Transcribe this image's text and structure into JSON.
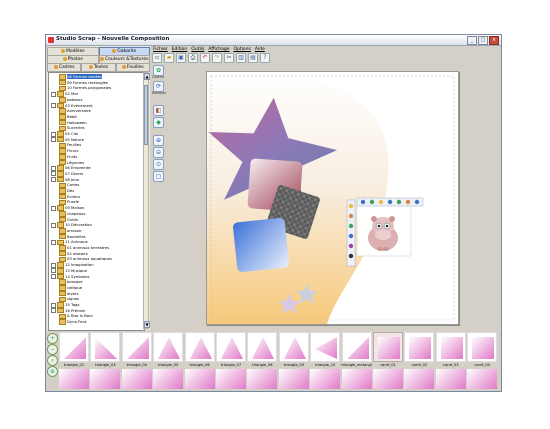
{
  "window": {
    "title": "Studio Scrap - Nouvelle Composition",
    "buttons": [
      "_",
      "□",
      "×"
    ]
  },
  "left_tabs": {
    "row1": [
      "Modèles",
      "Gabarits"
    ],
    "row2": [
      "Photos",
      "Couleurs &Textures"
    ],
    "row3": [
      "Cadres",
      "Textes",
      "Feuilles"
    ]
  },
  "tree": [
    {
      "label": "08 Formes carrées",
      "level": 2,
      "selected": true
    },
    {
      "label": "09 Formes rectangles",
      "level": 2
    },
    {
      "label": "10 Formes polygonales",
      "level": 2
    },
    {
      "label": "02 Mer",
      "level": 1
    },
    {
      "label": "bateaux",
      "level": 2
    },
    {
      "label": "03 Evénement",
      "level": 1
    },
    {
      "label": "Anniversaire",
      "level": 2
    },
    {
      "label": "Bébé",
      "level": 2
    },
    {
      "label": "Halloween",
      "level": 2
    },
    {
      "label": "Sucreries",
      "level": 2
    },
    {
      "label": "04 Ciel",
      "level": 1
    },
    {
      "label": "05 Nature",
      "level": 1
    },
    {
      "label": "Feuilles",
      "level": 2
    },
    {
      "label": "Fleurs",
      "level": 2
    },
    {
      "label": "Fruits",
      "level": 2
    },
    {
      "label": "Légumes",
      "level": 2
    },
    {
      "label": "06 Empreinte",
      "level": 1
    },
    {
      "label": "07 Divers",
      "level": 1
    },
    {
      "label": "08 Jeux",
      "level": 1
    },
    {
      "label": "Cartes",
      "level": 2
    },
    {
      "label": "Dés",
      "level": 2
    },
    {
      "label": "Echecs",
      "level": 2
    },
    {
      "label": "Puzzle",
      "level": 2
    },
    {
      "label": "09 Maison",
      "level": 1
    },
    {
      "label": "chapeaux",
      "level": 2
    },
    {
      "label": "Outils",
      "level": 2
    },
    {
      "label": "10 Décoration",
      "level": 1
    },
    {
      "label": "arrosoir",
      "level": 2
    },
    {
      "label": "Bouteilles",
      "level": 2
    },
    {
      "label": "11 Animaux",
      "level": 1
    },
    {
      "label": "01 animaux terrestres",
      "level": 2
    },
    {
      "label": "02 oiseaux",
      "level": 2
    },
    {
      "label": "03 animaux aquatiques",
      "level": 2
    },
    {
      "label": "12 Imagination",
      "level": 1
    },
    {
      "label": "13 Musique",
      "level": 1
    },
    {
      "label": "14 Symboles",
      "level": 1
    },
    {
      "label": "baroque",
      "level": 2
    },
    {
      "label": "celtique",
      "level": 2
    },
    {
      "label": "divers",
      "level": 2
    },
    {
      "label": "signes",
      "level": 2
    },
    {
      "label": "15 Tags",
      "level": 1
    },
    {
      "label": "16 Prénom",
      "level": 1
    },
    {
      "label": "A Star Is Born",
      "level": 2
    },
    {
      "label": "Dyna Font",
      "level": 2
    }
  ],
  "menu": [
    "Fichier",
    "Edition",
    "Outils",
    "Affichage",
    "Options",
    "Aide"
  ],
  "toolbar_icons": [
    "new-icon",
    "open-icon",
    "save-icon",
    "print-icon",
    "undo-icon",
    "redo-icon",
    "cut-icon",
    "layout-icon",
    "page-icon",
    "help-icon"
  ],
  "side_tools": [
    "Galerie",
    "Rotation",
    "Ajuster",
    "zoom-in",
    "zoom-out",
    "zoom-fit",
    "fullscreen"
  ],
  "thumbnails": [
    {
      "label": "triangle_01",
      "shape": "tri-right"
    },
    {
      "label": "triangle_03",
      "shape": "tri-left"
    },
    {
      "label": "triangle_04",
      "shape": "tri-right"
    },
    {
      "label": "triangle_05",
      "shape": "tri-up"
    },
    {
      "label": "triangle_06",
      "shape": "tri-up"
    },
    {
      "label": "triangle_07",
      "shape": "tri-up"
    },
    {
      "label": "triangle_08",
      "shape": "tri-up"
    },
    {
      "label": "triangle_09",
      "shape": "tri-up"
    },
    {
      "label": "triangle_10",
      "shape": "tri-wide"
    },
    {
      "label": "triangle_rectangl",
      "shape": "tri-rect"
    },
    {
      "label": "carré_01",
      "shape": "square",
      "selected": true
    },
    {
      "label": "carré_02",
      "shape": "square"
    },
    {
      "label": "carré_03",
      "shape": "square"
    },
    {
      "label": "carré_04",
      "shape": "square"
    }
  ],
  "colors": {
    "accent": "#316ac5",
    "pink": "#e07ac8",
    "star": "#8a78b0",
    "peach": "#f7c97a"
  }
}
